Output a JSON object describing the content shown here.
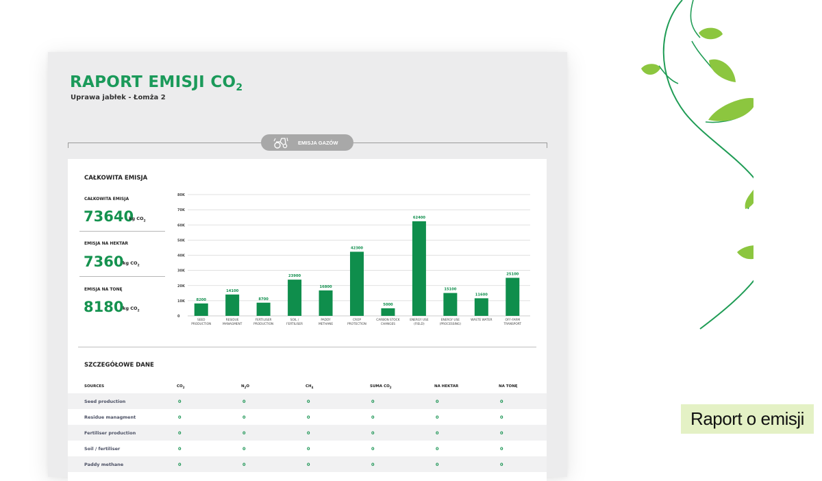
{
  "report": {
    "title": "RAPORT EMISJI CO",
    "title_sub": "2",
    "subtitle": "Uprawa jabłek - Łomża 2"
  },
  "tab": {
    "label": "EMISJA GAZÓW",
    "icon": "tractor-icon"
  },
  "summary": {
    "heading": "CAŁKOWITA EMISJA",
    "unit": "kg CO",
    "unit_sub": "2",
    "stats": [
      {
        "label": "CAŁKOWITA EMISJA",
        "value": "73640"
      },
      {
        "label": "EMISJA NA HEKTAR",
        "value": "7360"
      },
      {
        "label": "EMISJA NA TONĘ",
        "value": "8180"
      }
    ]
  },
  "chart_data": {
    "type": "bar",
    "color": "#0f8e4c",
    "ylim": [
      0,
      80000
    ],
    "yticks": [
      "0",
      "10K",
      "20K",
      "30K",
      "40K",
      "50K",
      "60K",
      "70K",
      "80K"
    ],
    "categories": [
      [
        "SEED",
        "PRODUCTION"
      ],
      [
        "RESIDUE",
        "MANAGMENT"
      ],
      [
        "FERTILISER",
        "PRODUCTION"
      ],
      [
        "SOIL /",
        "FERTILISER"
      ],
      [
        "PADDY",
        "METHANE"
      ],
      [
        "CROP",
        "PROTECTION"
      ],
      [
        "CARBON STOCK",
        "CHANGES"
      ],
      [
        "ENERGY USE",
        "(FIELD)"
      ],
      [
        "ENERGY USE",
        "(PROCESSING)"
      ],
      [
        "WASTE WATER"
      ],
      [
        "OFF-FARM",
        "TRANSPORT"
      ]
    ],
    "values": [
      8200,
      14100,
      8700,
      23900,
      16800,
      42300,
      5000,
      62400,
      15100,
      11600,
      25100
    ],
    "labels": [
      "8200",
      "14100",
      "8700",
      "23900",
      "16800",
      "42300",
      "5000",
      "62400",
      "15100",
      "11600",
      "25100"
    ]
  },
  "details": {
    "heading": "SZCZEGÓŁOWE DANE",
    "columns": [
      {
        "label": "SOURCES",
        "sub": ""
      },
      {
        "label": "CO",
        "sub": "2"
      },
      {
        "label": "N",
        "sub": "2",
        "suffix": "O"
      },
      {
        "label": "CH",
        "sub": "4"
      },
      {
        "label": "SUMA CO",
        "sub": "2"
      },
      {
        "label": "NA HEKTAR",
        "sub": ""
      },
      {
        "label": "NA TONĘ",
        "sub": ""
      }
    ],
    "rows": [
      {
        "source": "Seed production",
        "values": [
          "0",
          "0",
          "0",
          "0",
          "0",
          "0"
        ]
      },
      {
        "source": "Residue managment",
        "values": [
          "0",
          "0",
          "0",
          "0",
          "0",
          "0"
        ]
      },
      {
        "source": "Fertiliser production",
        "values": [
          "0",
          "0",
          "0",
          "0",
          "0",
          "0"
        ]
      },
      {
        "source": "Soil / fertiliser",
        "values": [
          "0",
          "0",
          "0",
          "0",
          "0",
          "0"
        ]
      },
      {
        "source": "Paddy methane",
        "values": [
          "0",
          "0",
          "0",
          "0",
          "0",
          "0"
        ]
      }
    ]
  },
  "caption": "Raport o emisji",
  "colors": {
    "brand_green": "#15924f",
    "caption_bg": "#e4f1c5",
    "vine": "#1f9c55",
    "leaf": "#8cc63f"
  }
}
